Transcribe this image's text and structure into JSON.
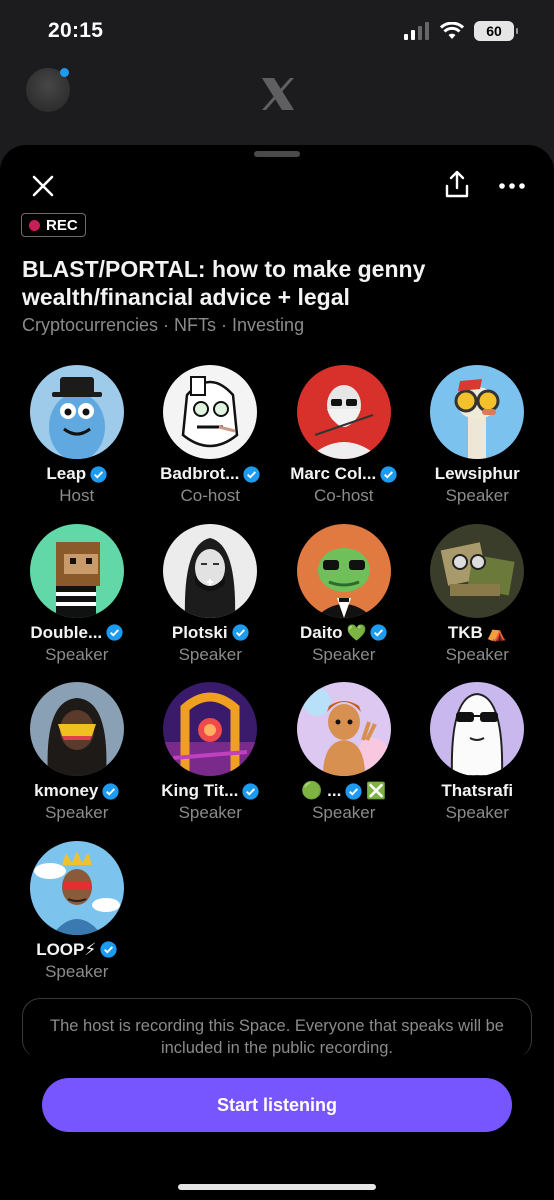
{
  "status_bar": {
    "time": "20:15",
    "battery": "60"
  },
  "space": {
    "rec_label": "REC",
    "title": "BLAST/PORTAL: how to make genny wealth/financial advice + legal",
    "topics": "Cryptocurrencies · NFTs · Investing"
  },
  "speakers": [
    {
      "name": "Leap",
      "role": "Host",
      "verified": true,
      "avatar": "blue-creature-top-hat"
    },
    {
      "name": "Badbrot...",
      "role": "Co-host",
      "verified": true,
      "avatar": "sketch-face"
    },
    {
      "name": "Marc Col...",
      "role": "Co-host",
      "verified": true,
      "avatar": "bearded-man-red"
    },
    {
      "name": "Lewsiphur",
      "role": "Speaker",
      "verified": false,
      "avatar": "ostrich-goggles"
    },
    {
      "name": "Double...",
      "role": "Speaker",
      "verified": true,
      "avatar": "pixel-ape"
    },
    {
      "name": "Plotski",
      "role": "Speaker",
      "verified": true,
      "avatar": "woman-mask"
    },
    {
      "name": "Daito",
      "role": "Speaker",
      "verified": true,
      "emoji": "💚",
      "avatar": "green-goblin-tux"
    },
    {
      "name": "TKB",
      "role": "Speaker",
      "verified": false,
      "emoji": "⛺",
      "avatar": "abstract-collage"
    },
    {
      "name": "kmoney",
      "role": "Speaker",
      "verified": true,
      "avatar": "hooded-visor"
    },
    {
      "name": "King Tit...",
      "role": "Speaker",
      "verified": true,
      "avatar": "neon-arch"
    },
    {
      "name": "🟢 ...",
      "role": "Speaker",
      "verified": true,
      "emoji": "❎",
      "avatar": "cartoon-boy-pastel"
    },
    {
      "name": "Thatsrafi",
      "role": "Speaker",
      "verified": false,
      "avatar": "sunglasses-blob"
    },
    {
      "name": "LOOP⚡",
      "role": "Speaker",
      "verified": true,
      "avatar": "crowned-sunglasses"
    }
  ],
  "record_notice": "The host is recording this Space. Everyone that speaks will be included in the public recording.",
  "start_button": "Start listening",
  "colors": {
    "accent": "#7856ff",
    "verified": "#1d9bf0",
    "rec": "#c81e5a"
  }
}
